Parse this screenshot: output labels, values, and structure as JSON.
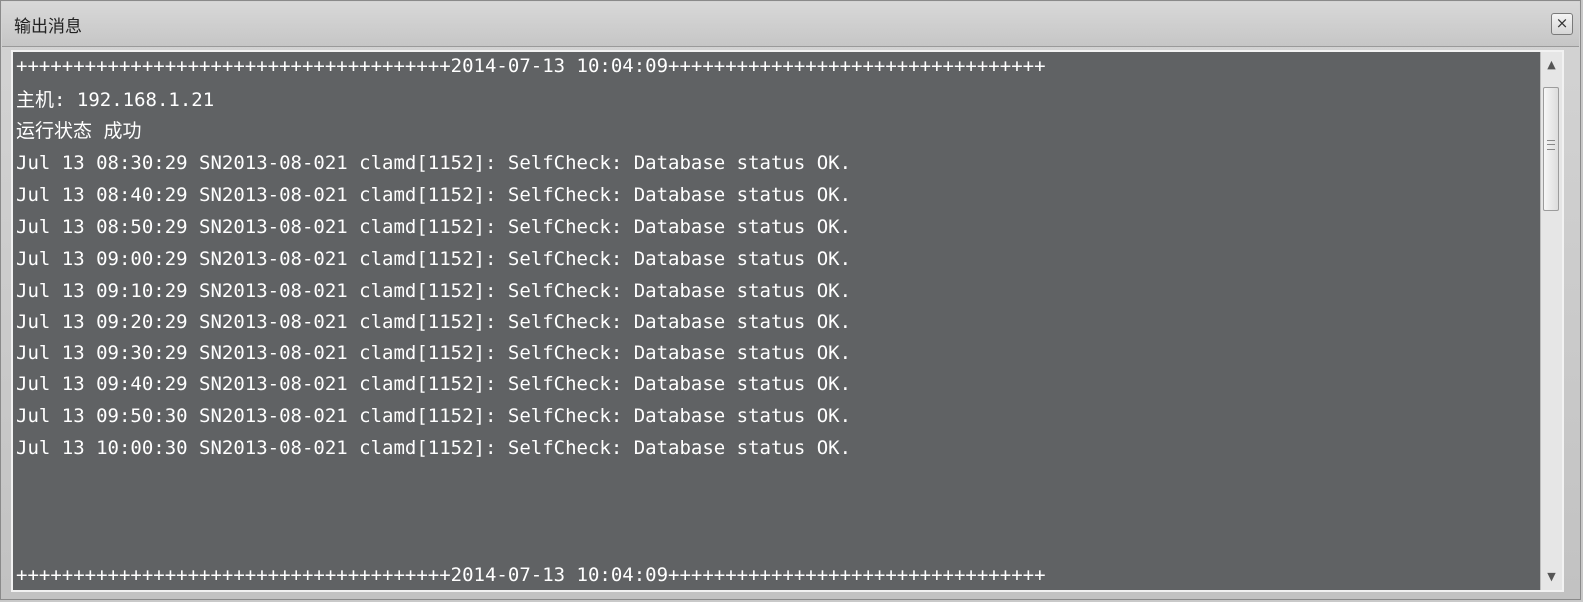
{
  "window": {
    "title": "输出消息",
    "close_label": "×"
  },
  "console": {
    "header_separator": "++++++++++++++++++++++++++++++++++++++2014-07-13 10:04:09+++++++++++++++++++++++++++++++++",
    "host_line": "主机: 192.168.1.21",
    "status_line": "运行状态 成功",
    "log_lines": [
      "Jul 13 08:30:29 SN2013-08-021 clamd[1152]: SelfCheck: Database status OK.",
      "Jul 13 08:40:29 SN2013-08-021 clamd[1152]: SelfCheck: Database status OK.",
      "Jul 13 08:50:29 SN2013-08-021 clamd[1152]: SelfCheck: Database status OK.",
      "Jul 13 09:00:29 SN2013-08-021 clamd[1152]: SelfCheck: Database status OK.",
      "Jul 13 09:10:29 SN2013-08-021 clamd[1152]: SelfCheck: Database status OK.",
      "Jul 13 09:20:29 SN2013-08-021 clamd[1152]: SelfCheck: Database status OK.",
      "Jul 13 09:30:29 SN2013-08-021 clamd[1152]: SelfCheck: Database status OK.",
      "Jul 13 09:40:29 SN2013-08-021 clamd[1152]: SelfCheck: Database status OK.",
      "Jul 13 09:50:30 SN2013-08-021 clamd[1152]: SelfCheck: Database status OK.",
      "Jul 13 10:00:30 SN2013-08-021 clamd[1152]: SelfCheck: Database status OK."
    ],
    "footer_separator": "++++++++++++++++++++++++++++++++++++++2014-07-13 10:04:09+++++++++++++++++++++++++++++++++"
  },
  "scrollbar": {
    "up_icon": "scroll-up-arrow-icon",
    "down_icon": "scroll-down-arrow-icon",
    "thumb_grip_icon": "grip-lines-icon"
  },
  "colors": {
    "console_background": "#606264",
    "console_text": "#ffffff"
  }
}
